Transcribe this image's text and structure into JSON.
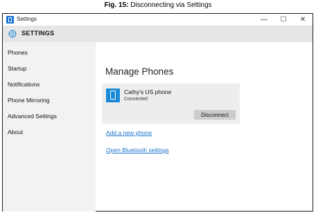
{
  "caption": {
    "prefix": "Fig. 15:",
    "text": " Disconnecting via Settings"
  },
  "window": {
    "title": "Settings",
    "minimize": "—",
    "maximize": "☐",
    "close": "✕"
  },
  "header": {
    "title": "SETTINGS",
    "icon": "gear-icon"
  },
  "sidebar": {
    "items": [
      {
        "label": "Phones"
      },
      {
        "label": "Startup"
      },
      {
        "label": "Notifications"
      },
      {
        "label": "Phone Mirroring"
      },
      {
        "label": "Advanced Settings"
      },
      {
        "label": "About"
      }
    ]
  },
  "main": {
    "title": "Manage Phones",
    "phone": {
      "name": "Cathy's US phone",
      "status": "Connected",
      "icon": "phone-icon",
      "disconnect_label": "Disconnect"
    },
    "links": [
      {
        "label": "Add a new phone"
      },
      {
        "label": "Open Bluetooth settings"
      }
    ]
  },
  "colors": {
    "accent": "#1b8ad9",
    "link": "#1a73c9",
    "header_bg": "#e6e6e6",
    "sidebar_bg": "#f2f2f2"
  }
}
